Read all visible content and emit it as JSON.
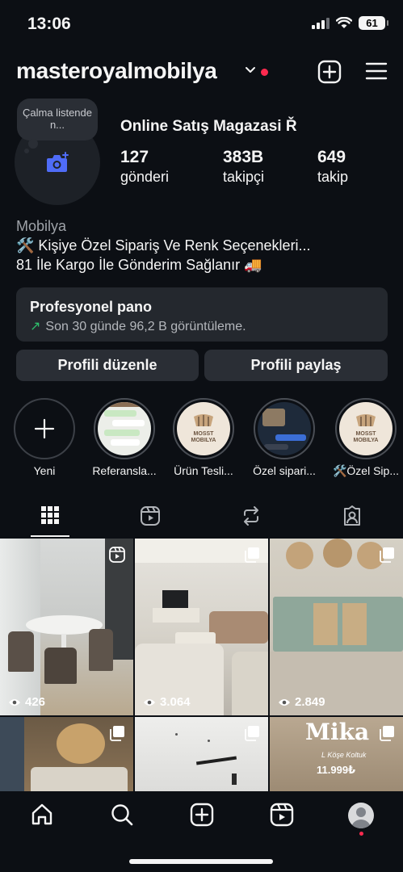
{
  "status": {
    "time": "13:06",
    "battery": "61"
  },
  "profile": {
    "username": "masteroyalmobilya",
    "note": "Çalma listende n...",
    "display_name": "Online Satış Magazasi Ř",
    "stats": [
      {
        "value": "127",
        "label": "gönderi"
      },
      {
        "value": "383B",
        "label": "takipçi"
      },
      {
        "value": "649",
        "label": "takip"
      }
    ],
    "category": "Mobilya",
    "bio_line1": "🛠️ Kişiye Özel Sipariş Ve Renk Seçenekleri...",
    "bio_line2": "81 İle Kargo İle Gönderim Sağlanır 🚚"
  },
  "pro_panel": {
    "title": "Profesyonel pano",
    "subtitle": "Son 30 günde 96,2 B görüntüleme."
  },
  "buttons": {
    "edit": "Profili düzenle",
    "share": "Profili paylaş"
  },
  "highlights": [
    {
      "label": "Yeni"
    },
    {
      "label": "Referansla..."
    },
    {
      "label": "Ürün Tesli..."
    },
    {
      "label": "Özel sipari..."
    },
    {
      "label": "🛠️Özel Sip..."
    }
  ],
  "highlight_logo_text": [
    "MOSST",
    "MOBILYA"
  ],
  "tabs": [
    "grid-icon",
    "reels-icon",
    "reposts-icon",
    "tagged-icon"
  ],
  "posts": [
    {
      "views": "426",
      "type": "reel"
    },
    {
      "views": "3.064",
      "type": "carousel"
    },
    {
      "views": "2.849",
      "type": "carousel"
    },
    {
      "views": "",
      "type": "carousel"
    },
    {
      "views": "",
      "type": "carousel"
    },
    {
      "views": "",
      "type": "carousel",
      "title": "Mika",
      "subtitle": "L Köşe Koltuk",
      "price": "11.999₺"
    }
  ],
  "nav": [
    "home-icon",
    "search-icon",
    "create-icon",
    "reels-icon",
    "profile-icon"
  ],
  "colors": {
    "background": "#0c0f14",
    "panel": "#24282e",
    "notification": "#ff2a4f",
    "trend": "#2ec06c"
  }
}
